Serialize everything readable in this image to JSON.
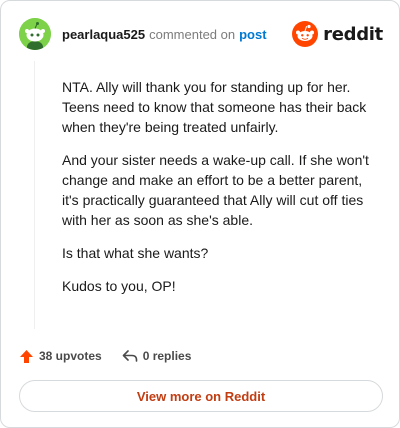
{
  "header": {
    "username": "pearlaqua525",
    "commented_text": "commented on",
    "post_link": "post",
    "brand": "reddit"
  },
  "comment": {
    "paragraphs": [
      "NTA. Ally will thank you for standing up for her. Teens need to know that someone has their back when they're being treated unfairly.",
      "And your sister needs a wake-up call. If she won't change and make an effort to be a better parent, it's practically guaranteed that Ally will cut off ties with her as soon as she's able.",
      "Is that what she wants?",
      "Kudos to you, OP!"
    ]
  },
  "actions": {
    "upvotes": "38 upvotes",
    "replies": "0 replies"
  },
  "footer": {
    "view_more": "View more on Reddit"
  },
  "colors": {
    "accent_orange": "#ff4500",
    "link_blue": "#0079d3",
    "avatar_green": "#7dd24a"
  },
  "icons": [
    "snoo-avatar-icon",
    "reddit-logo-icon",
    "upvote-arrow-icon",
    "reply-arrow-icon"
  ]
}
